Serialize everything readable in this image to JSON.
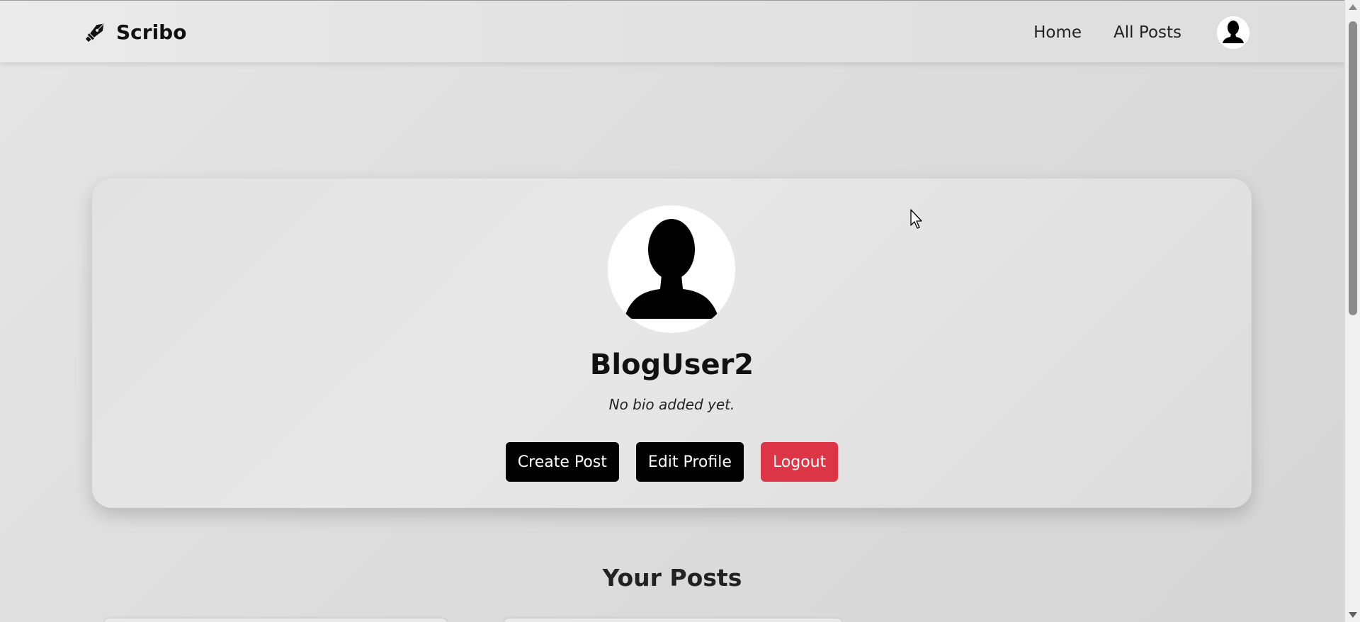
{
  "navbar": {
    "brand": "Scribo",
    "links": [
      {
        "label": "Home"
      },
      {
        "label": "All Posts"
      }
    ]
  },
  "profile": {
    "username": "BlogUser2",
    "bio": "No bio added yet.",
    "actions": {
      "create_post": "Create Post",
      "edit_profile": "Edit Profile",
      "logout": "Logout"
    }
  },
  "posts_section": {
    "title": "Your Posts"
  },
  "colors": {
    "primary_button": "#000000",
    "danger_button": "#dc3545",
    "background": "#dcdcdc"
  },
  "icons": {
    "brand": "fountain-pen-icon",
    "avatar": "user-silhouette-icon"
  }
}
